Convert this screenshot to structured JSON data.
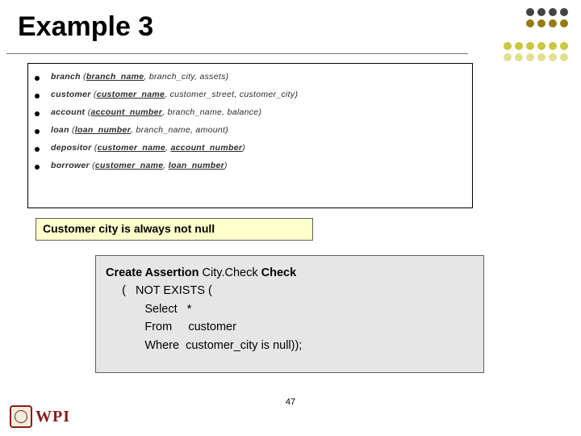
{
  "title": "Example 3",
  "schema": [
    {
      "name": "branch",
      "keys": [
        "branch_name"
      ],
      "cols": [
        "branch_city",
        "assets"
      ]
    },
    {
      "name": "customer",
      "keys": [
        "customer_name"
      ],
      "cols": [
        "customer_street",
        "customer_city"
      ]
    },
    {
      "name": "account",
      "keys": [
        "account_number"
      ],
      "cols": [
        "branch_name",
        "balance"
      ]
    },
    {
      "name": "loan",
      "keys": [
        "loan_number"
      ],
      "cols": [
        "branch_name",
        "amount"
      ]
    },
    {
      "name": "depositor",
      "keys": [
        "customer_name",
        "account_number"
      ],
      "cols": []
    },
    {
      "name": "borrower",
      "keys": [
        "customer_name",
        "loan_number"
      ],
      "cols": []
    }
  ],
  "statement": "Customer city is always not null",
  "code": {
    "l1a": "Create Assertion ",
    "l1b": "City.Check ",
    "l1c": "Check",
    "l2": "     (   NOT EXISTS (",
    "l3": "            Select   *",
    "l4": "            From     customer",
    "l5": "            Where  customer_city is null));"
  },
  "page_number": "47",
  "logo_text": "WPI"
}
